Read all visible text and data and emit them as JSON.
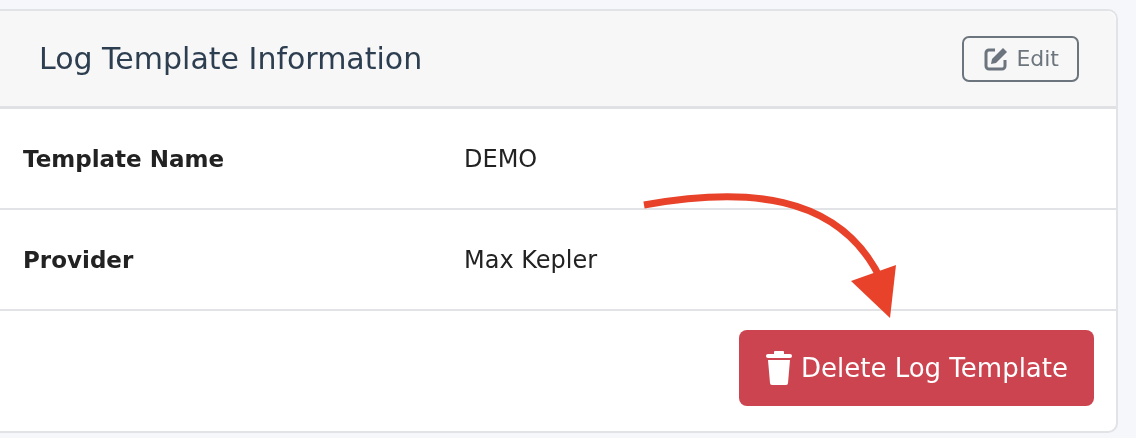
{
  "card": {
    "title": "Log Template Information",
    "edit_button": {
      "label": "Edit"
    }
  },
  "rows": [
    {
      "label": "Template Name",
      "value": "DEMO"
    },
    {
      "label": "Provider",
      "value": "Max Kepler"
    }
  ],
  "delete_button": {
    "label": "Delete Log Template"
  }
}
